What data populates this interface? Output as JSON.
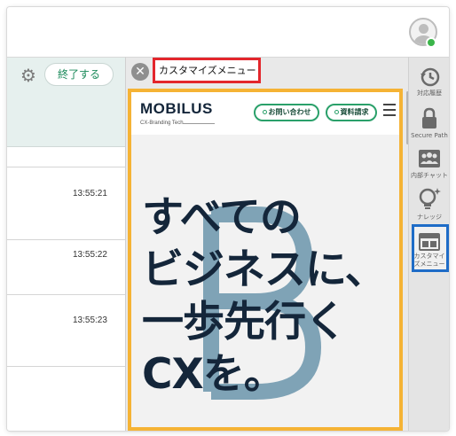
{
  "header": {
    "avatar_status": "online",
    "status_color": "#3bb54a"
  },
  "left_panel": {
    "end_button": "終了する",
    "times": [
      "13:55:21",
      "13:55:22",
      "13:55:23"
    ]
  },
  "center": {
    "tab_title": "カスタマイズメニュー",
    "web": {
      "logo": "MOBILUS",
      "logo_sub": "CX-Branding Tech.",
      "pill_contact": "お問い合わせ",
      "pill_docs": "資料請求",
      "hero_lines": [
        "すべての",
        "ビジネスに、",
        "一歩先行く",
        "CXを。"
      ]
    }
  },
  "sidebar": {
    "items": [
      {
        "label": "対応履歴",
        "icon": "history-icon"
      },
      {
        "label": "Secure Path",
        "icon": "lock-icon"
      },
      {
        "label": "内部チャット",
        "icon": "team-chat-icon"
      },
      {
        "label": "ナレッジ",
        "icon": "lightbulb-icon"
      },
      {
        "label": "カスタマイズメニュー",
        "icon": "layout-icon"
      }
    ]
  },
  "colors": {
    "accent_green": "#2aa06a",
    "highlight_red": "#e3262c",
    "highlight_orange": "#f5b335",
    "highlight_blue": "#1e6cc7",
    "hero_text": "#14263a"
  }
}
